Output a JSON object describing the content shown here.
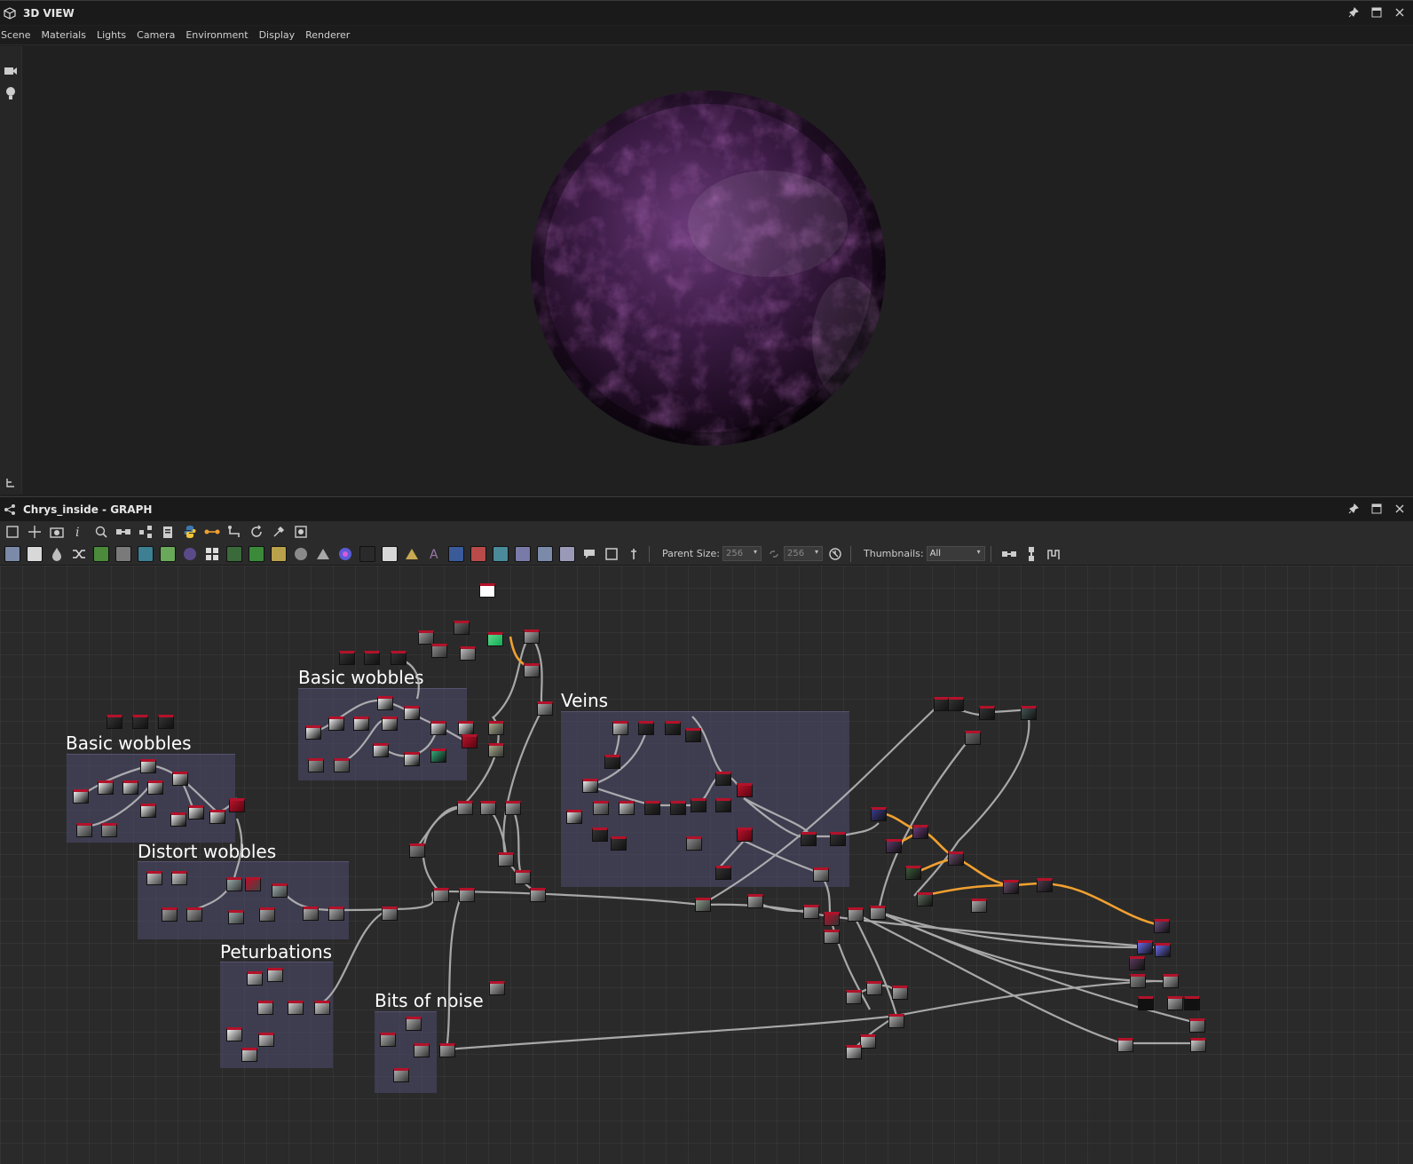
{
  "view3d": {
    "title": "3D VIEW",
    "menu": [
      "Scene",
      "Materials",
      "Lights",
      "Camera",
      "Environment",
      "Display",
      "Renderer"
    ],
    "side_icons": [
      "camera-icon",
      "light-bulb-icon",
      "hierarchy-icon"
    ],
    "window_icons": [
      "pin-icon",
      "maximize-icon",
      "close-icon"
    ],
    "sphere_colors": {
      "base": "#3a1b40",
      "light": "#7a4a88",
      "dark": "#120812"
    }
  },
  "graph": {
    "title": "Chrys_inside - GRAPH",
    "window_icons": [
      "pin-icon",
      "maximize-icon",
      "close-icon"
    ],
    "toolbar1_icons": [
      "frame-all-icon",
      "move-icon",
      "camera-snapshot-icon",
      "info-icon",
      "zoom-icon",
      "link-icon",
      "share-icon",
      "clipboard-icon",
      "python-icon",
      "connect-icon",
      "path-icon",
      "refresh-icon",
      "tools-icon",
      "export-icon"
    ],
    "toolbar2_icons": [
      {
        "name": "bitmap-icon",
        "color": "#7a8aa8"
      },
      {
        "name": "svg-icon",
        "color": "#d8d8d8"
      },
      {
        "name": "drop-icon",
        "color": "#bdbdbd"
      },
      {
        "name": "shuffle-icon",
        "color": "#dcdcdc"
      },
      {
        "name": "curve-icon",
        "color": "#4a8a3a"
      },
      {
        "name": "levels-icon",
        "color": "#7a7a7a"
      },
      {
        "name": "gradient-map-icon",
        "color": "#3d7f93"
      },
      {
        "name": "pen-icon",
        "color": "#6aa85a"
      },
      {
        "name": "sphere-icon",
        "color": "#5a4a8a"
      },
      {
        "name": "tile-icon",
        "color": "#dcdcdc"
      },
      {
        "name": "tile-generator-icon",
        "color": "#3a6a3a"
      },
      {
        "name": "fx-map-icon",
        "color": "#3a8a3a"
      },
      {
        "name": "blend-icon",
        "color": "#b9a04a"
      },
      {
        "name": "hsl-icon",
        "color": "#8a8a8a"
      },
      {
        "name": "warp-icon",
        "color": "#a8a8a8"
      },
      {
        "name": "color-wheel-icon",
        "color": "#5a5ad8"
      },
      {
        "name": "noise-icon",
        "color": "#2a2a2a"
      },
      {
        "name": "transform-icon",
        "color": "#d7d7d7"
      },
      {
        "name": "triangle-icon",
        "color": "#c8a850"
      },
      {
        "name": "text-icon",
        "color": "#9a7aa8"
      },
      {
        "name": "select-icon",
        "color": "#3a5a9a"
      },
      {
        "name": "fill-icon",
        "color": "#b84a4a"
      },
      {
        "name": "pattern-icon",
        "color": "#4a8a9a"
      },
      {
        "name": "mask-icon",
        "color": "#7a7aa8"
      },
      {
        "name": "split-icon",
        "color": "#7a8aa8"
      },
      {
        "name": "output-icon",
        "color": "#9a9ab8"
      }
    ],
    "toolbar2_extra_icons": [
      "comment-icon",
      "frame-icon",
      "pin-node-icon"
    ],
    "parent_size": {
      "label": "Parent Size:",
      "w": "256",
      "h": "256"
    },
    "thumbnails": {
      "label": "Thumbnails:",
      "value": "All"
    },
    "right_icons": [
      "align-horizontal-icon",
      "align-vertical-icon",
      "snap-icon"
    ],
    "frames": [
      "Basic wobbles",
      "Basic wobbles",
      "Distort wobbles",
      "Peturbations",
      "Bits of noise",
      "Veins"
    ],
    "colors": {
      "wire": "#bfbfbf",
      "wire_orange": "#f0a030",
      "node_top": "#b3122a",
      "frame": "#4e4a6e"
    }
  }
}
